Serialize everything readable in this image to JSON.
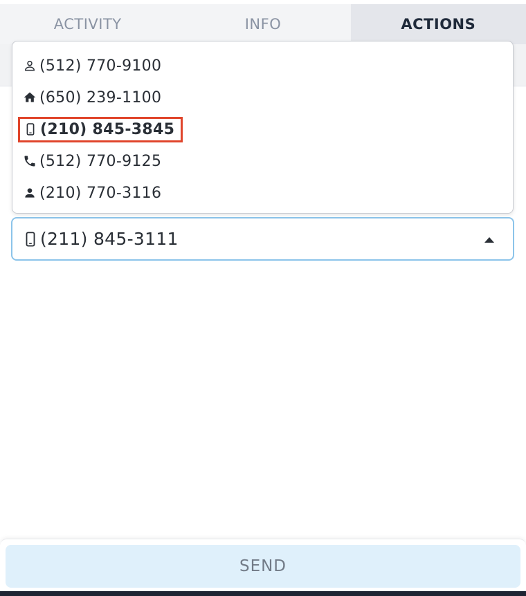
{
  "tabs": [
    {
      "label": "ACTIVITY",
      "active": false
    },
    {
      "label": "INFO",
      "active": false
    },
    {
      "label": "ACTIONS",
      "active": true
    }
  ],
  "dropdown": {
    "items": [
      {
        "icon": "person-outline-icon",
        "number": "(512) 770-9100"
      },
      {
        "icon": "home-icon",
        "number": "(650) 239-1100"
      },
      {
        "icon": "mobile-phone-icon",
        "number": "(210) 845-3845",
        "highlighted": true
      },
      {
        "icon": "phone-icon",
        "number": "(512) 770-9125"
      },
      {
        "icon": "person-icon",
        "number": "(210) 770-3116"
      }
    ]
  },
  "select": {
    "icon": "mobile-phone-icon",
    "value": "(211) 845-3111"
  },
  "send_label": "SEND",
  "colors": {
    "accent": "#4aa8e8",
    "highlight_border": "#e0452b",
    "send_bg": "#dff0fb",
    "select_border": "#8cc4ea"
  }
}
